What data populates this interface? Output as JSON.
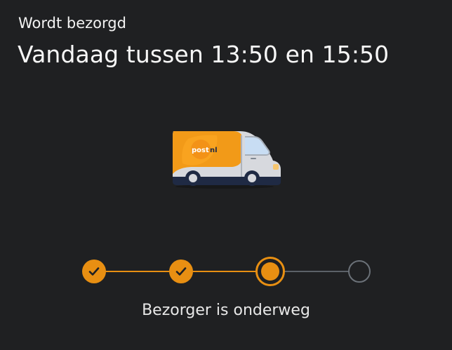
{
  "delivery": {
    "status_label": "Wordt bezorgd",
    "time_window": "Vandaag tussen 13:50 en 15:50",
    "current_step": 3,
    "total_steps": 4,
    "current_step_label": "Bezorger is onderweg"
  },
  "colors": {
    "background": "#1f2022",
    "accent": "#e88f12",
    "inactive": "#5b6168"
  },
  "icons": {
    "van": "delivery-van-icon",
    "check": "check-icon"
  },
  "brand": {
    "logo_text": "postnl"
  }
}
